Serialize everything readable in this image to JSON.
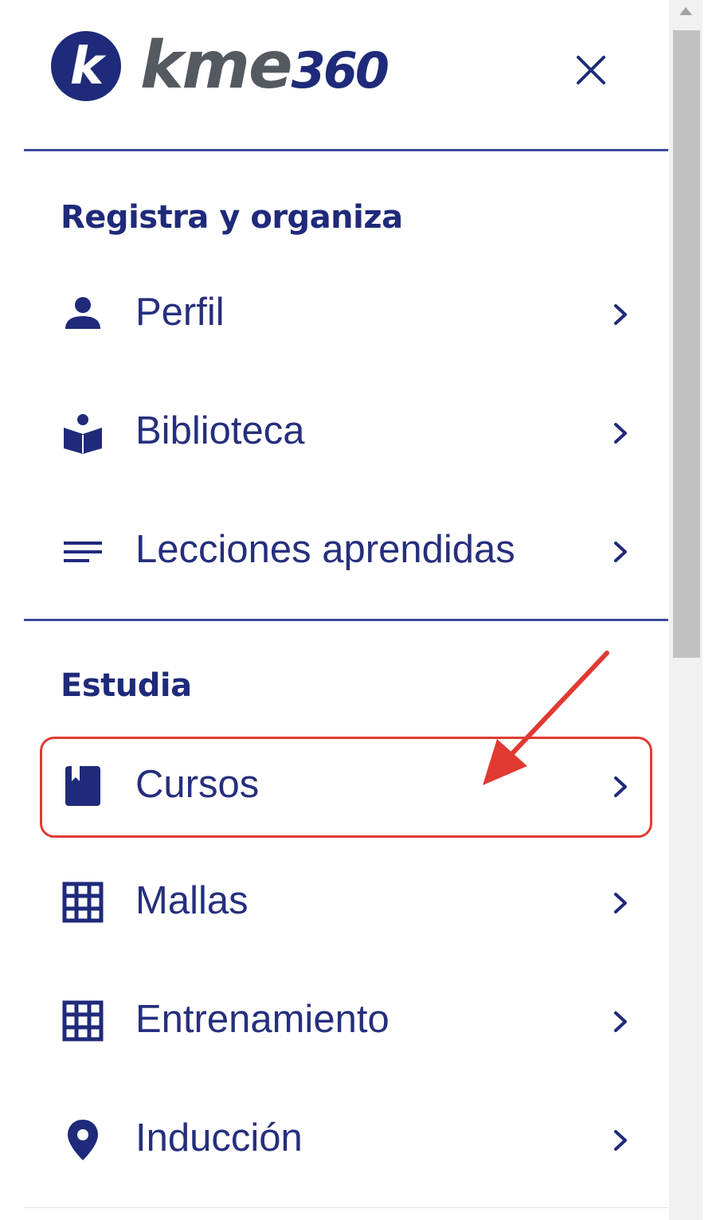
{
  "header": {
    "logo_letter": "k",
    "logo_text": "kme",
    "logo_number": "360",
    "close_icon": "close-icon"
  },
  "sections": [
    {
      "title": "Registra y organiza",
      "items": [
        {
          "label": "Perfil",
          "icon": "person-icon"
        },
        {
          "label": "Biblioteca",
          "icon": "book-reader-icon"
        },
        {
          "label": "Lecciones aprendidas",
          "icon": "lines-icon"
        }
      ]
    },
    {
      "title": "Estudia",
      "items": [
        {
          "label": "Cursos",
          "icon": "notebook-icon",
          "highlighted": true
        },
        {
          "label": "Mallas",
          "icon": "grid-icon"
        },
        {
          "label": "Entrenamiento",
          "icon": "grid-icon"
        },
        {
          "label": "Inducción",
          "icon": "location-pin-icon"
        }
      ]
    }
  ],
  "colors": {
    "brand_navy": "#1f2a7a",
    "logo_gray": "#555960",
    "divider": "#3d4a9c",
    "annotation_red": "#e03a33",
    "scrollbar_track": "#f1f1f1",
    "scrollbar_thumb": "#c1c1c1"
  }
}
